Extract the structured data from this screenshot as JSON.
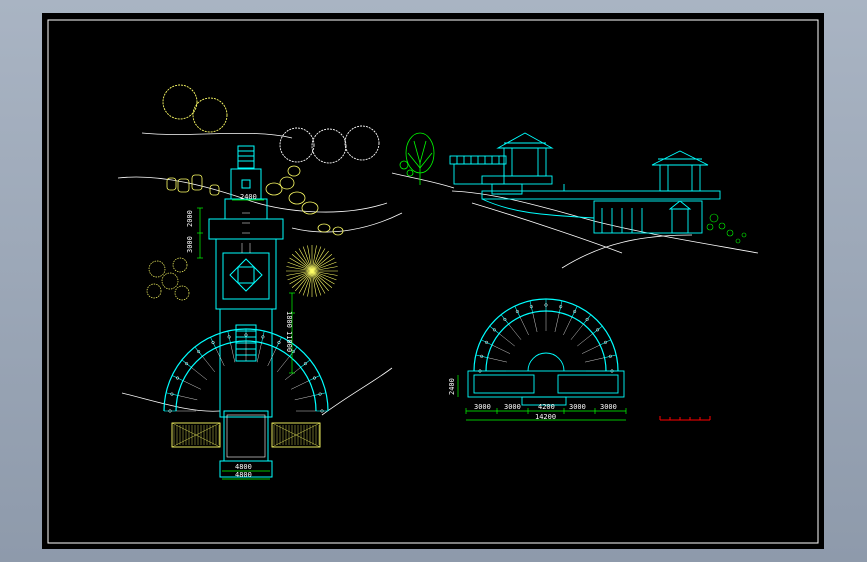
{
  "drawing": {
    "colors": {
      "background": "#000000",
      "border": "#ffffff",
      "cyan": "#00ffff",
      "green": "#00ff00",
      "yellow": "#ffff66",
      "white": "#ffffff",
      "red": "#ff0000"
    },
    "plan_dimensions": {
      "top_width": "2400",
      "left_upper": "2000",
      "left_lower": "3000",
      "right_a": "1800",
      "right_b": "11000",
      "bottom_width": "4800",
      "bottom_total": "4800"
    },
    "arc_plan_dimensions": {
      "seg1": "3000",
      "seg2": "3000",
      "seg3": "4200",
      "seg4": "3000",
      "seg5": "3000",
      "total": "14200",
      "left_height": "2400"
    }
  }
}
